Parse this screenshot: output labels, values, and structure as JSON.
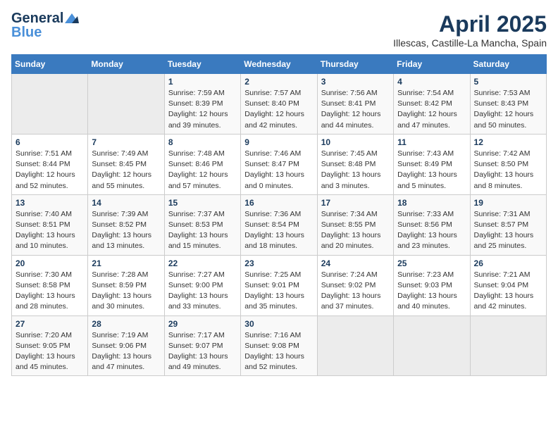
{
  "header": {
    "logo": {
      "general": "General",
      "blue": "Blue"
    },
    "title": "April 2025",
    "subtitle": "Illescas, Castille-La Mancha, Spain"
  },
  "calendar": {
    "weekdays": [
      "Sunday",
      "Monday",
      "Tuesday",
      "Wednesday",
      "Thursday",
      "Friday",
      "Saturday"
    ],
    "weeks": [
      [
        {
          "day": "",
          "content": ""
        },
        {
          "day": "",
          "content": ""
        },
        {
          "day": "1",
          "content": "Sunrise: 7:59 AM\nSunset: 8:39 PM\nDaylight: 12 hours and 39 minutes."
        },
        {
          "day": "2",
          "content": "Sunrise: 7:57 AM\nSunset: 8:40 PM\nDaylight: 12 hours and 42 minutes."
        },
        {
          "day": "3",
          "content": "Sunrise: 7:56 AM\nSunset: 8:41 PM\nDaylight: 12 hours and 44 minutes."
        },
        {
          "day": "4",
          "content": "Sunrise: 7:54 AM\nSunset: 8:42 PM\nDaylight: 12 hours and 47 minutes."
        },
        {
          "day": "5",
          "content": "Sunrise: 7:53 AM\nSunset: 8:43 PM\nDaylight: 12 hours and 50 minutes."
        }
      ],
      [
        {
          "day": "6",
          "content": "Sunrise: 7:51 AM\nSunset: 8:44 PM\nDaylight: 12 hours and 52 minutes."
        },
        {
          "day": "7",
          "content": "Sunrise: 7:49 AM\nSunset: 8:45 PM\nDaylight: 12 hours and 55 minutes."
        },
        {
          "day": "8",
          "content": "Sunrise: 7:48 AM\nSunset: 8:46 PM\nDaylight: 12 hours and 57 minutes."
        },
        {
          "day": "9",
          "content": "Sunrise: 7:46 AM\nSunset: 8:47 PM\nDaylight: 13 hours and 0 minutes."
        },
        {
          "day": "10",
          "content": "Sunrise: 7:45 AM\nSunset: 8:48 PM\nDaylight: 13 hours and 3 minutes."
        },
        {
          "day": "11",
          "content": "Sunrise: 7:43 AM\nSunset: 8:49 PM\nDaylight: 13 hours and 5 minutes."
        },
        {
          "day": "12",
          "content": "Sunrise: 7:42 AM\nSunset: 8:50 PM\nDaylight: 13 hours and 8 minutes."
        }
      ],
      [
        {
          "day": "13",
          "content": "Sunrise: 7:40 AM\nSunset: 8:51 PM\nDaylight: 13 hours and 10 minutes."
        },
        {
          "day": "14",
          "content": "Sunrise: 7:39 AM\nSunset: 8:52 PM\nDaylight: 13 hours and 13 minutes."
        },
        {
          "day": "15",
          "content": "Sunrise: 7:37 AM\nSunset: 8:53 PM\nDaylight: 13 hours and 15 minutes."
        },
        {
          "day": "16",
          "content": "Sunrise: 7:36 AM\nSunset: 8:54 PM\nDaylight: 13 hours and 18 minutes."
        },
        {
          "day": "17",
          "content": "Sunrise: 7:34 AM\nSunset: 8:55 PM\nDaylight: 13 hours and 20 minutes."
        },
        {
          "day": "18",
          "content": "Sunrise: 7:33 AM\nSunset: 8:56 PM\nDaylight: 13 hours and 23 minutes."
        },
        {
          "day": "19",
          "content": "Sunrise: 7:31 AM\nSunset: 8:57 PM\nDaylight: 13 hours and 25 minutes."
        }
      ],
      [
        {
          "day": "20",
          "content": "Sunrise: 7:30 AM\nSunset: 8:58 PM\nDaylight: 13 hours and 28 minutes."
        },
        {
          "day": "21",
          "content": "Sunrise: 7:28 AM\nSunset: 8:59 PM\nDaylight: 13 hours and 30 minutes."
        },
        {
          "day": "22",
          "content": "Sunrise: 7:27 AM\nSunset: 9:00 PM\nDaylight: 13 hours and 33 minutes."
        },
        {
          "day": "23",
          "content": "Sunrise: 7:25 AM\nSunset: 9:01 PM\nDaylight: 13 hours and 35 minutes."
        },
        {
          "day": "24",
          "content": "Sunrise: 7:24 AM\nSunset: 9:02 PM\nDaylight: 13 hours and 37 minutes."
        },
        {
          "day": "25",
          "content": "Sunrise: 7:23 AM\nSunset: 9:03 PM\nDaylight: 13 hours and 40 minutes."
        },
        {
          "day": "26",
          "content": "Sunrise: 7:21 AM\nSunset: 9:04 PM\nDaylight: 13 hours and 42 minutes."
        }
      ],
      [
        {
          "day": "27",
          "content": "Sunrise: 7:20 AM\nSunset: 9:05 PM\nDaylight: 13 hours and 45 minutes."
        },
        {
          "day": "28",
          "content": "Sunrise: 7:19 AM\nSunset: 9:06 PM\nDaylight: 13 hours and 47 minutes."
        },
        {
          "day": "29",
          "content": "Sunrise: 7:17 AM\nSunset: 9:07 PM\nDaylight: 13 hours and 49 minutes."
        },
        {
          "day": "30",
          "content": "Sunrise: 7:16 AM\nSunset: 9:08 PM\nDaylight: 13 hours and 52 minutes."
        },
        {
          "day": "",
          "content": ""
        },
        {
          "day": "",
          "content": ""
        },
        {
          "day": "",
          "content": ""
        }
      ]
    ]
  }
}
